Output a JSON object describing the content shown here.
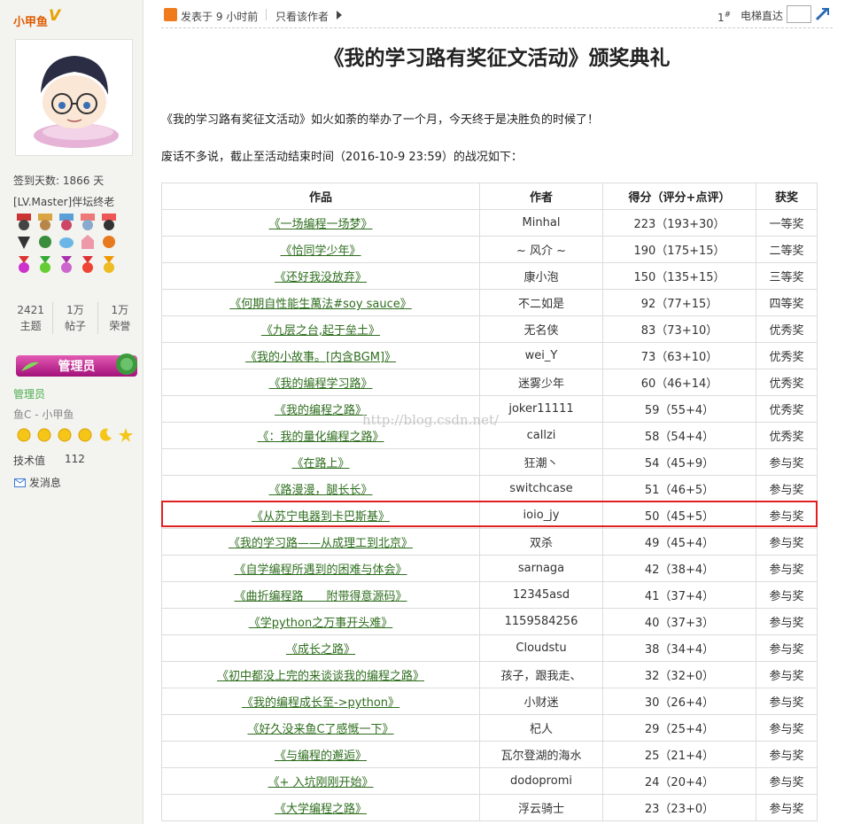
{
  "sidebar": {
    "username": "小甲鱼",
    "vip_badge": "V",
    "signin_days": "签到天数: 1866 天",
    "level": "[LV.Master]伴坛终老",
    "stats": [
      {
        "value": "2421",
        "label": "主题"
      },
      {
        "value": "1万",
        "label": "帖子"
      },
      {
        "value": "1万",
        "label": "荣誉"
      }
    ],
    "admin_badge": "管理员",
    "group_label": "管理员",
    "forum_label": "鱼C - 小甲鱼",
    "tech_label": "技术值",
    "tech_value": "112",
    "message_link": "发消息"
  },
  "toolbar": {
    "posted_time": "发表于 9 小时前",
    "only_author": "只看该作者",
    "floor": "1",
    "floor_sup": "#",
    "jump_label": "电梯直达",
    "jump_value": ""
  },
  "post": {
    "title": "《我的学习路有奖征文活动》颁奖典礼",
    "para1": "《我的学习路有奖征文活动》如火如荼的举办了一个月，今天终于是决胜负的时候了！",
    "para2": "废话不多说，截止至活动结束时间（2016-10-9 23:59）的战况如下：",
    "watermark": "http://blog.csdn.net/"
  },
  "table": {
    "headers": [
      "作品",
      "作者",
      "得分（评分+点评）",
      "获奖"
    ],
    "rows": [
      {
        "work": "《一场编程一场梦》",
        "author": "Minhal",
        "score": "223（193+30）",
        "award": "一等奖"
      },
      {
        "work": "《恰同学少年》",
        "author": "~ 风介 ~",
        "score": "190（175+15）",
        "award": "二等奖"
      },
      {
        "work": "《还好我没放弃》",
        "author": "康小泡",
        "score": "150（135+15）",
        "award": "三等奖"
      },
      {
        "work": "《何期自性能生萬法#soy sauce》",
        "author": "不二如是",
        "score": "92（77+15）",
        "award": "四等奖"
      },
      {
        "work": "《九层之台,起于垒土》",
        "author": "无名侠",
        "score": "83（73+10）",
        "award": "优秀奖"
      },
      {
        "work": "《我的小故事。[内含BGM]》",
        "author": "wei_Y",
        "score": "73（63+10）",
        "award": "优秀奖"
      },
      {
        "work": "《我的编程学习路》",
        "author": "迷雾少年",
        "score": "60（46+14）",
        "award": "优秀奖"
      },
      {
        "work": "《我的编程之路》",
        "author": "joker11111",
        "score": "59（55+4）",
        "award": "优秀奖"
      },
      {
        "work": "《：我的量化编程之路》",
        "author": "callzi",
        "score": "58（54+4）",
        "award": "优秀奖"
      },
      {
        "work": "《在路上》",
        "author": "狂潮丶",
        "score": "54（45+9）",
        "award": "参与奖"
      },
      {
        "work": "《路漫漫，腿长长》",
        "author": "switchcase",
        "score": "51（46+5）",
        "award": "参与奖"
      },
      {
        "work": "《从苏宁电器到卡巴斯基》",
        "author": "ioio_jy",
        "score": "50（45+5）",
        "award": "参与奖"
      },
      {
        "work": "《我的学习路——从成理工到北京》",
        "author": "双杀",
        "score": "49（45+4）",
        "award": "参与奖"
      },
      {
        "work": "《自学编程所遇到的困难与体会》",
        "author": "sarnaga",
        "score": "42（38+4）",
        "award": "参与奖"
      },
      {
        "work": "《曲折编程路　　附带得意源码》",
        "author": "12345asd",
        "score": "41（37+4）",
        "award": "参与奖"
      },
      {
        "work": "《学python之万事开头难》",
        "author": "1159584256",
        "score": "40（37+3）",
        "award": "参与奖"
      },
      {
        "work": "《成长之路》",
        "author": "Cloudstu",
        "score": "38（34+4）",
        "award": "参与奖"
      },
      {
        "work": "《初中都没上完的来谈谈我的编程之路》",
        "author": "孩子，跟我走、",
        "score": "32（32+0）",
        "award": "参与奖"
      },
      {
        "work": "《我的编程成长至->python》",
        "author": "小财迷",
        "score": "30（26+4）",
        "award": "参与奖"
      },
      {
        "work": "《好久没来鱼C了感慨一下》",
        "author": "杞人",
        "score": "29（25+4）",
        "award": "参与奖"
      },
      {
        "work": "《与编程的邂逅》",
        "author": "瓦尔登湖的海水",
        "score": "25（21+4）",
        "award": "参与奖"
      },
      {
        "work": "《+ 入坑刚刚开始》",
        "author": "dodopromi",
        "score": "24（20+4）",
        "award": "参与奖"
      },
      {
        "work": "《大学编程之路》",
        "author": "浮云骑士",
        "score": "23（23+0）",
        "award": "参与奖"
      }
    ]
  },
  "colors": {
    "accent": "#e05a00",
    "link_green": "#2e6e1e",
    "highlight_red": "#e02020",
    "admin_pink": "#c2268f"
  }
}
